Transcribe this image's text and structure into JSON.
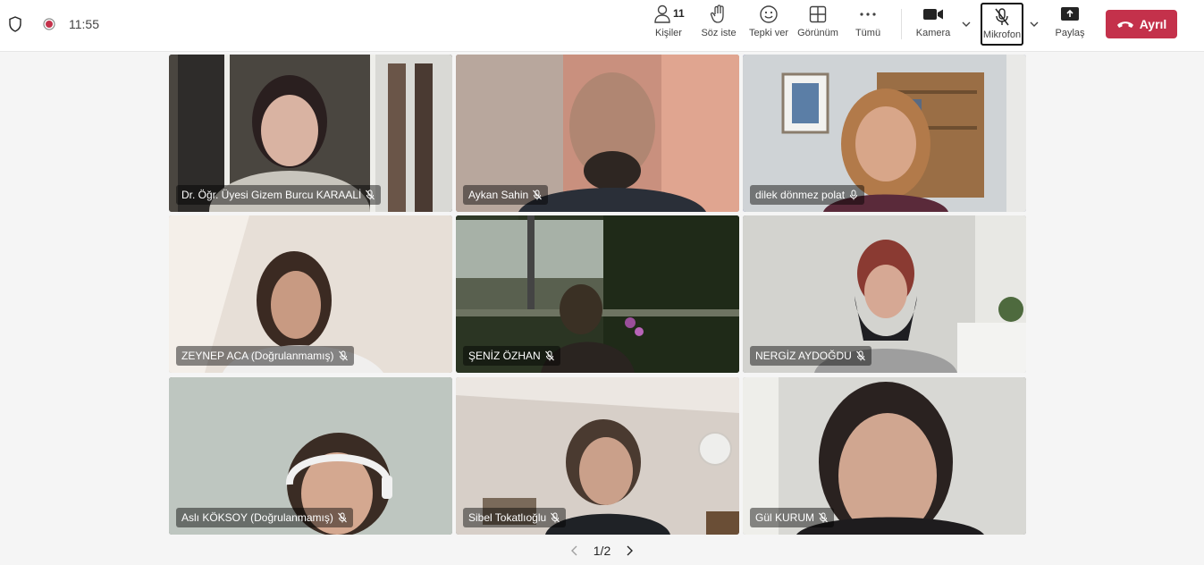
{
  "header": {
    "time": "11:55",
    "people_count": "11",
    "buttons": {
      "people": "Kişiler",
      "raise_hand": "Söz iste",
      "react": "Tepki ver",
      "view": "Görünüm",
      "more": "Tümü",
      "camera": "Kamera",
      "mic": "Mikrofon",
      "share": "Paylaş"
    },
    "leave_label": "Ayrıl",
    "leave_color": "#c4314b"
  },
  "participants": [
    {
      "name": "Dr. Öğr. Üyesi Gizem Burcu KARAALİ",
      "muted": true
    },
    {
      "name": "Aykan Sahin",
      "muted": true
    },
    {
      "name": "dilek dönmez polat",
      "muted": false,
      "speaking": true
    },
    {
      "name": "ZEYNEP ACA (Doğrulanmamış)",
      "muted": true
    },
    {
      "name": "ŞENİZ ÖZHAN",
      "muted": true
    },
    {
      "name": "NERGİZ AYDOĞDU",
      "muted": true
    },
    {
      "name": "Aslı KÖKSOY (Doğrulanmamış)",
      "muted": true
    },
    {
      "name": "Sibel Tokatlıoğlu",
      "muted": true
    },
    {
      "name": "Gül KURUM",
      "muted": true
    }
  ],
  "pager": {
    "label": "1/2"
  },
  "icons": [
    "shield-icon",
    "record-icon",
    "people-icon",
    "hand-icon",
    "emoji-icon",
    "grid-icon",
    "more-icon",
    "camera-icon",
    "mic-off-icon",
    "share-icon",
    "phone-icon",
    "chevron-down-icon",
    "chevron-left-icon",
    "chevron-right-icon"
  ],
  "colors": {
    "accent": "#5b5fc7",
    "leave": "#c4314b",
    "record": "#c4314b"
  }
}
